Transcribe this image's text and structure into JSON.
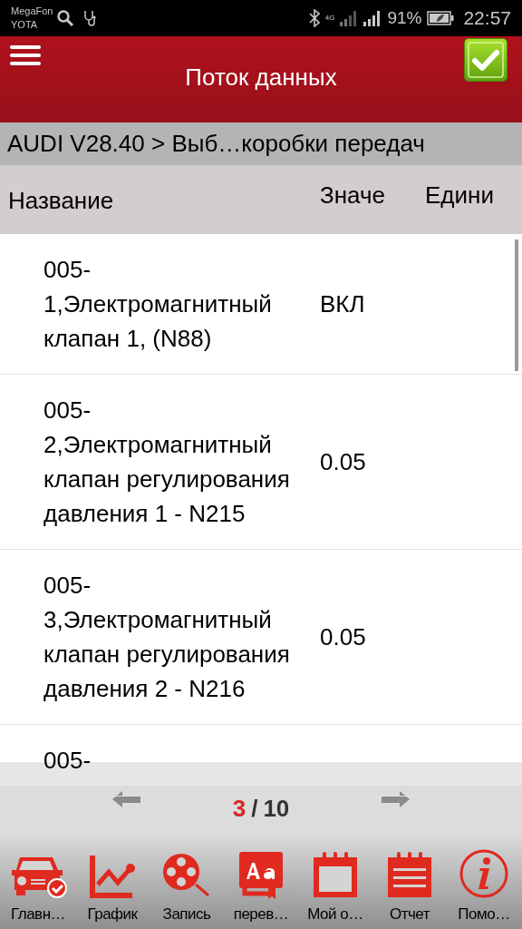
{
  "status_bar": {
    "carriers": [
      "MegaFon",
      "YOTA"
    ],
    "network": "4G",
    "battery": "91%",
    "time": "22:57"
  },
  "header": {
    "title": "Поток данных"
  },
  "breadcrumb": "AUDI V28.40 > Выб…коробки передач",
  "columns": [
    "Название",
    "Значе",
    "Едини"
  ],
  "rows": [
    {
      "name": "005-1,Электромагнитный клапан 1, (N88)",
      "value": "ВКЛ"
    },
    {
      "name": "005-2,Электромагнитный клапан регулирования давления 1 - N215",
      "value": "0.05"
    },
    {
      "name": "005-3,Электромагнитный клапан регулирования давления 2 - N216",
      "value": "0.05"
    },
    {
      "name": "005-"
    }
  ],
  "pager": {
    "current": "3",
    "separator": "/",
    "total": "10"
  },
  "toolbar": [
    {
      "kind": "car",
      "label": "Главн…"
    },
    {
      "kind": "graph",
      "label": "График"
    },
    {
      "kind": "reel",
      "label": "Запись"
    },
    {
      "kind": "translate",
      "label": "перев…"
    },
    {
      "kind": "calendar",
      "label": "Мой о…"
    },
    {
      "kind": "report",
      "label": "Отчет"
    },
    {
      "kind": "info",
      "label": "Помо…"
    }
  ]
}
